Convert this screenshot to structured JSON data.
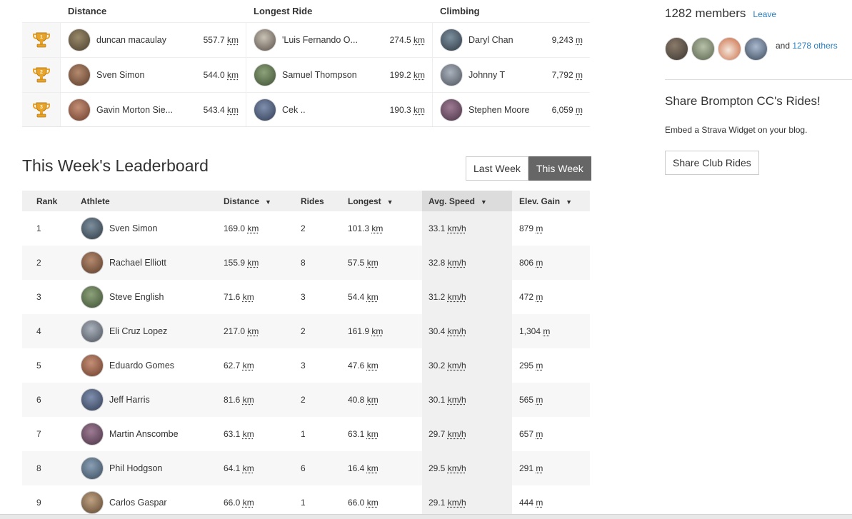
{
  "leaders": {
    "headers": {
      "distance": "Distance",
      "longest": "Longest Ride",
      "climbing": "Climbing"
    },
    "trophy_colors": {
      "gold": "#e8a32a",
      "dark": "#b37a10"
    },
    "rows": [
      {
        "rank": "1",
        "distance": {
          "name": "duncan macaulay",
          "value": "557.7",
          "unit": "km"
        },
        "longest": {
          "name": "'Luis Fernando O...",
          "value": "274.5",
          "unit": "km"
        },
        "climbing": {
          "name": "Daryl Chan",
          "value": "9,243",
          "unit": "m"
        }
      },
      {
        "rank": "2",
        "distance": {
          "name": "Sven Simon",
          "value": "544.0",
          "unit": "km"
        },
        "longest": {
          "name": "Samuel Thompson",
          "value": "199.2",
          "unit": "km"
        },
        "climbing": {
          "name": "Johnny T",
          "value": "7,792",
          "unit": "m"
        }
      },
      {
        "rank": "3",
        "distance": {
          "name": "Gavin Morton Sie...",
          "value": "543.4",
          "unit": "km"
        },
        "longest": {
          "name": "Cek ..",
          "value": "190.3",
          "unit": "km"
        },
        "climbing": {
          "name": "Stephen Moore",
          "value": "6,059",
          "unit": "m"
        }
      }
    ]
  },
  "leaderboard": {
    "title": "This Week's Leaderboard",
    "toggle": {
      "last_week": "Last Week",
      "this_week": "This Week",
      "active": "this_week"
    },
    "columns": {
      "rank": "Rank",
      "athlete": "Athlete",
      "distance": "Distance",
      "rides": "Rides",
      "longest": "Longest",
      "speed": "Avg. Speed",
      "elev": "Elev. Gain"
    },
    "sort_arrow": "▼",
    "units": {
      "distance": "km",
      "speed": "km/h",
      "elev": "m"
    },
    "rows": [
      {
        "rank": "1",
        "athlete": "Sven Simon",
        "distance": "169.0",
        "rides": "2",
        "longest": "101.3",
        "speed": "33.1",
        "elev": "879"
      },
      {
        "rank": "2",
        "athlete": "Rachael Elliott",
        "distance": "155.9",
        "rides": "8",
        "longest": "57.5",
        "speed": "32.8",
        "elev": "806"
      },
      {
        "rank": "3",
        "athlete": "Steve English",
        "distance": "71.6",
        "rides": "3",
        "longest": "54.4",
        "speed": "31.2",
        "elev": "472"
      },
      {
        "rank": "4",
        "athlete": "Eli Cruz Lopez",
        "distance": "217.0",
        "rides": "2",
        "longest": "161.9",
        "speed": "30.4",
        "elev": "1,304"
      },
      {
        "rank": "5",
        "athlete": "Eduardo Gomes",
        "distance": "62.7",
        "rides": "3",
        "longest": "47.6",
        "speed": "30.2",
        "elev": "295"
      },
      {
        "rank": "6",
        "athlete": "Jeff Harris",
        "distance": "81.6",
        "rides": "2",
        "longest": "40.8",
        "speed": "30.1",
        "elev": "565"
      },
      {
        "rank": "7",
        "athlete": "Martin Anscombe",
        "distance": "63.1",
        "rides": "1",
        "longest": "63.1",
        "speed": "29.7",
        "elev": "657"
      },
      {
        "rank": "8",
        "athlete": "Phil Hodgson",
        "distance": "64.1",
        "rides": "6",
        "longest": "16.4",
        "speed": "29.5",
        "elev": "291"
      },
      {
        "rank": "9",
        "athlete": "Carlos Gaspar",
        "distance": "66.0",
        "rides": "1",
        "longest": "66.0",
        "speed": "29.1",
        "elev": "444"
      }
    ]
  },
  "sidebar": {
    "members_count": "1282 members",
    "leave": "Leave",
    "others_prefix": "and",
    "others_link": "1278 others",
    "share_title": "Share Brompton CC's Rides!",
    "share_desc": "Embed a Strava Widget on your blog.",
    "share_button": "Share Club Rides"
  },
  "colors": {
    "link": "#2d7fbf",
    "active_toggle": "#666666",
    "sorted_column": "#dcdcdc"
  }
}
